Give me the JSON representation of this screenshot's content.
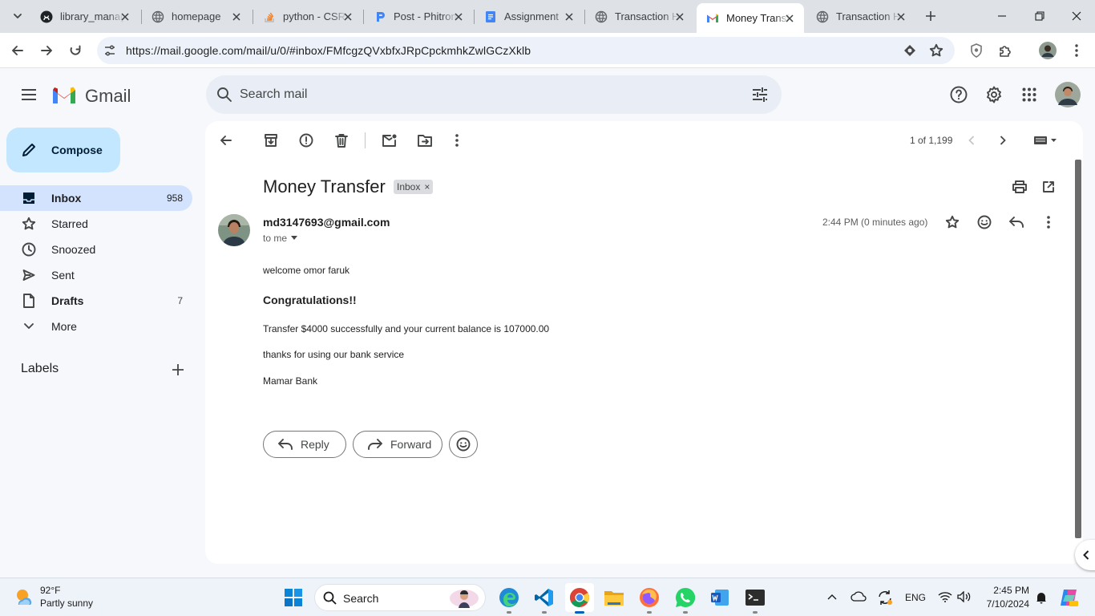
{
  "browser": {
    "tabs": [
      {
        "title": "library_management",
        "icon": "github-icon"
      },
      {
        "title": "homepage",
        "icon": "globe-icon"
      },
      {
        "title": "python - CSRF",
        "icon": "stackoverflow-icon"
      },
      {
        "title": "Post - Phitron",
        "icon": "phitron-icon"
      },
      {
        "title": "Assignment",
        "icon": "docs-icon"
      },
      {
        "title": "Transaction History",
        "icon": "globe-icon"
      },
      {
        "title": "Money Transfer",
        "icon": "gmail-icon",
        "active": true
      },
      {
        "title": "Transaction History",
        "icon": "globe-icon"
      }
    ],
    "url": "https://mail.google.com/mail/u/0/#inbox/FMfcgzQVxbfxJRpCpckmhkZwlGCzXklb"
  },
  "gmail": {
    "logo_text": "Gmail",
    "search_placeholder": "Search mail",
    "compose_label": "Compose",
    "nav": [
      {
        "label": "Inbox",
        "count": "958",
        "icon": "inbox-icon"
      },
      {
        "label": "Starred",
        "count": "",
        "icon": "star-icon"
      },
      {
        "label": "Snoozed",
        "count": "",
        "icon": "clock-icon"
      },
      {
        "label": "Sent",
        "count": "",
        "icon": "send-icon"
      },
      {
        "label": "Drafts",
        "count": "7",
        "icon": "draft-icon"
      },
      {
        "label": "More",
        "count": "",
        "icon": "chevron-down-icon"
      }
    ],
    "labels_title": "Labels",
    "pagination": "1 of 1,199"
  },
  "email": {
    "subject": "Money Transfer",
    "label_chip": "Inbox",
    "label_chip_close": "×",
    "sender": "md3147693@gmail.com",
    "to": "to me",
    "date": "2:44 PM (0 minutes ago)",
    "greeting": "welcome omor faruk",
    "heading": "Congratulations!!",
    "line1": "Transfer $4000 successfully and your current balance is 107000.00",
    "line2": "thanks for using our bank service",
    "signature": "Mamar Bank",
    "reply_label": "Reply",
    "forward_label": "Forward"
  },
  "taskbar": {
    "weather_temp": "92°F",
    "weather_desc": "Partly sunny",
    "search_label": "Search",
    "lang": "ENG",
    "time": "2:45 PM",
    "date": "7/10/2024"
  },
  "colors": {
    "gmail_bg": "#f6f8fc",
    "compose": "#c2e7ff",
    "nav_active": "#d3e3fd",
    "search_bg": "#e9eef6",
    "tabstrip": "#dee1e6"
  }
}
